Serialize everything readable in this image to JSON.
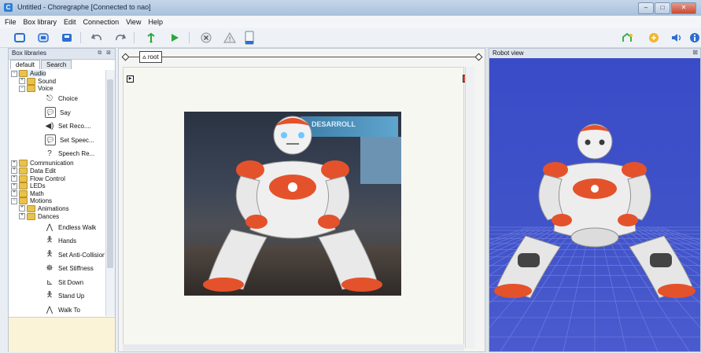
{
  "window": {
    "app_icon": "C",
    "title": "Untitled - Choregraphe [Connected to nao]",
    "controls": [
      "–",
      "□",
      "✕"
    ]
  },
  "menu": [
    "File",
    "Box library",
    "Edit",
    "Connection",
    "View",
    "Help"
  ],
  "toolbar_icons": [
    "new-icon",
    "open-icon",
    "save-icon",
    "undo-icon",
    "redo-icon",
    "connect-icon",
    "play-icon",
    "stop-icon",
    "debug-icon",
    "warning-icon",
    "device-icon",
    "wake-up-icon",
    "animation-icon",
    "volume-icon"
  ],
  "left_panel": {
    "title": "Box libraries",
    "header_buttons": "⧉ ⊠",
    "tabs": [
      "default",
      "Search"
    ],
    "tree": [
      {
        "label": "Audio",
        "level": 0,
        "exp": "−"
      },
      {
        "label": "Sound",
        "level": 1,
        "exp": "+"
      },
      {
        "label": "Voice",
        "level": 1,
        "exp": "−"
      }
    ],
    "voice_boxes": [
      {
        "label": "Choice",
        "icon": "choice-icon",
        "glyph": "⎋"
      },
      {
        "label": "Say",
        "icon": "say-icon",
        "glyph": "💬"
      },
      {
        "label": "Set Reco....",
        "icon": "speech-reco-icon",
        "glyph": "◀)"
      },
      {
        "label": "Set Speec...",
        "icon": "speech-settings-icon",
        "glyph": "💬"
      },
      {
        "label": "Speech Re...",
        "icon": "ear-icon",
        "glyph": "?"
      }
    ],
    "tree2": [
      {
        "label": "Communication",
        "level": 0,
        "exp": "+"
      },
      {
        "label": "Data Edit",
        "level": 0,
        "exp": "+"
      },
      {
        "label": "Flow Control",
        "level": 0,
        "exp": "+"
      },
      {
        "label": "LEDs",
        "level": 0,
        "exp": "+"
      },
      {
        "label": "Math",
        "level": 0,
        "exp": "+"
      },
      {
        "label": "Motions",
        "level": 0,
        "exp": "−"
      },
      {
        "label": "Animations",
        "level": 1,
        "exp": "+"
      },
      {
        "label": "Dances",
        "level": 1,
        "exp": "+"
      }
    ],
    "motion_boxes": [
      {
        "label": "Endless Walk",
        "icon": "walk-icon",
        "glyph": "⋀"
      },
      {
        "label": "Hands",
        "icon": "hands-icon",
        "glyph": "🯅"
      },
      {
        "label": "Set Anti-Collision",
        "icon": "anti-collision-icon",
        "glyph": "🯅"
      },
      {
        "label": "Set Stiffness",
        "icon": "stiffness-icon",
        "glyph": "☸"
      },
      {
        "label": "Sit Down",
        "icon": "sit-down-icon",
        "glyph": "⊾"
      },
      {
        "label": "Stand Up",
        "icon": "stand-up-icon",
        "glyph": "🯅"
      },
      {
        "label": "Walk To",
        "icon": "walk-to-icon",
        "glyph": "⋀"
      }
    ]
  },
  "flow": {
    "root_label": "root",
    "photo_banner": "DESARROLL"
  },
  "robot_view": {
    "title": "Robot view",
    "close": "⊠"
  },
  "colors": {
    "nao_orange": "#e4522c",
    "nao_white": "#eeeeee",
    "view_blue": "#3f52c8"
  }
}
